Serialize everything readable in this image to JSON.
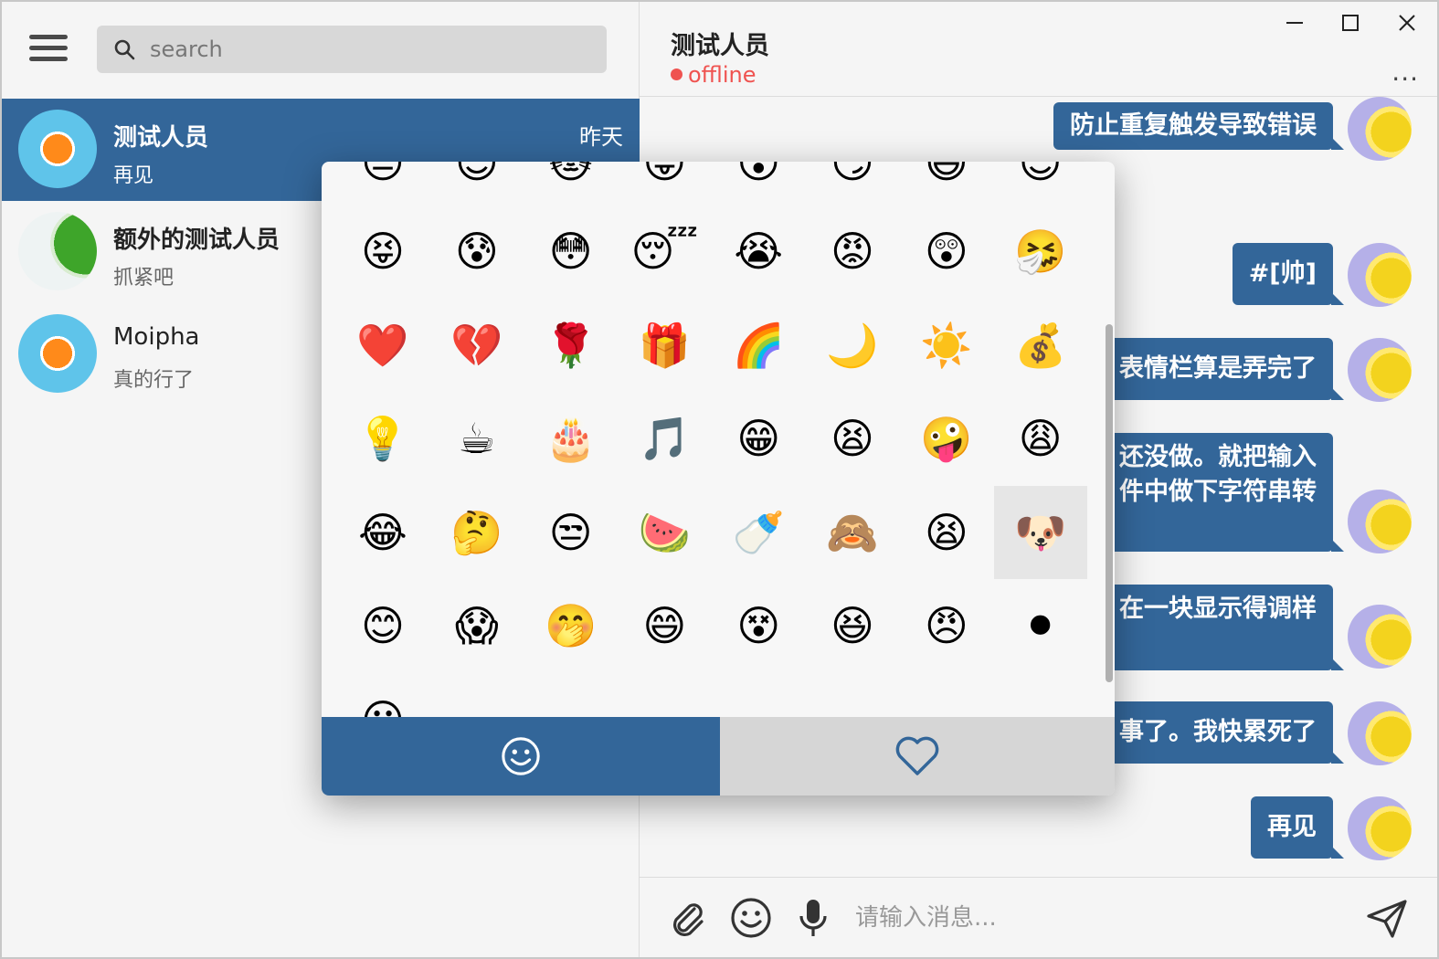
{
  "sidebar": {
    "search_placeholder": "search",
    "conversations": [
      {
        "name": "测试人员",
        "preview": "再见",
        "time": "昨天",
        "active": true
      },
      {
        "name": "额外的测试人员",
        "preview": "抓紧吧",
        "time": ""
      },
      {
        "name": "Moipha",
        "preview": "真的行了",
        "time": ""
      }
    ]
  },
  "chat": {
    "contact_name": "测试人员",
    "status": "offline",
    "more_label": "···",
    "messages": [
      {
        "lines": [
          "防止重复触发导致错误"
        ]
      },
      {
        "lines": [
          "#[帅]"
        ]
      },
      {
        "lines": [
          "表情栏算是弄完了"
        ]
      },
      {
        "lines": [
          "还没做。就把输入",
          "件中做下字符串转"
        ]
      },
      {
        "lines": [
          "在一块显示得调样"
        ]
      },
      {
        "lines": [
          "事了。我快累死了"
        ]
      },
      {
        "lines": [
          "再见"
        ]
      }
    ],
    "input_placeholder": "请输入消息..."
  },
  "emoji_panel": {
    "rows": [
      [
        "😑",
        "😊",
        "🐱",
        "😛",
        "😮",
        "😏",
        "😆",
        "😊"
      ],
      [
        "😝",
        "😰",
        "😳",
        "😴",
        "😭",
        "😡",
        "😲",
        "🤧"
      ],
      [
        "❤️",
        "💔",
        "🌹",
        "🎁",
        "🌈",
        "🌙",
        "☀️",
        "💰"
      ],
      [
        "💡",
        "☕",
        "🎂",
        "🎵",
        "😁",
        "😫",
        "🤪",
        "😩"
      ],
      [
        "😂",
        "🤔",
        "😒",
        "🍉",
        "🍼",
        "🙈",
        "😫",
        "🐶"
      ],
      [
        "😊",
        "😱",
        "🤭",
        "😄",
        "😵",
        "😆",
        "😠",
        "⚫"
      ],
      [
        "😶"
      ]
    ],
    "selected": "4.7"
  },
  "colors": {
    "accent": "#336699",
    "offline": "#ef5350"
  }
}
